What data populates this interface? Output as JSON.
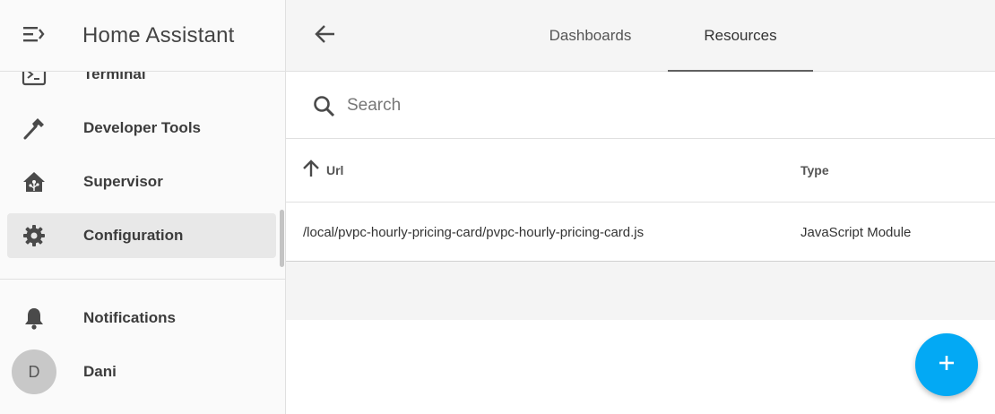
{
  "sidebar": {
    "app_title": "Home Assistant",
    "items": [
      {
        "label": "Terminal",
        "icon": "terminal-icon"
      },
      {
        "label": "Developer Tools",
        "icon": "hammer-icon"
      },
      {
        "label": "Supervisor",
        "icon": "home-assistant-icon"
      },
      {
        "label": "Configuration",
        "icon": "gear-icon",
        "selected": true
      }
    ],
    "notifications_label": "Notifications",
    "user": {
      "initial": "D",
      "name": "Dani"
    }
  },
  "topbar": {
    "tabs": [
      {
        "label": "Dashboards",
        "active": false
      },
      {
        "label": "Resources",
        "active": true
      }
    ]
  },
  "search": {
    "placeholder": "Search",
    "value": ""
  },
  "table": {
    "columns": {
      "url": "Url",
      "type": "Type"
    },
    "sort": "url-ascending",
    "rows": [
      {
        "url": "/local/pvpc-hourly-pricing-card/pvpc-hourly-pricing-card.js",
        "type": "JavaScript Module"
      }
    ]
  },
  "colors": {
    "accent": "#03a9f4",
    "selected_bg": "#e8e8e8",
    "icon": "#4a4a4a"
  }
}
